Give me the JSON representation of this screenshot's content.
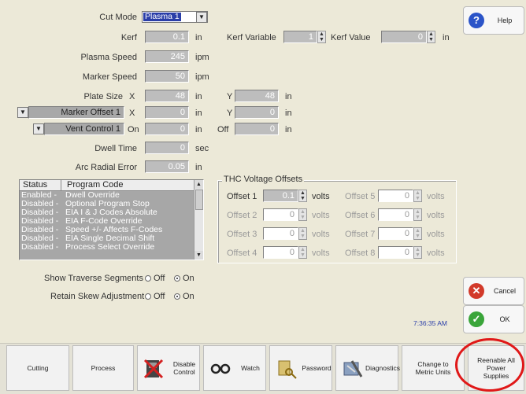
{
  "cut_mode": {
    "label": "Cut Mode",
    "value": "Plasma 1"
  },
  "kerf": {
    "label": "Kerf",
    "value": "0.1",
    "unit": "in"
  },
  "kerf_variable": {
    "label": "Kerf Variable",
    "value": "1"
  },
  "kerf_value": {
    "label": "Kerf Value",
    "value": "0",
    "unit": "in"
  },
  "plasma_speed": {
    "label": "Plasma Speed",
    "value": "245",
    "unit": "ipm"
  },
  "marker_speed": {
    "label": "Marker Speed",
    "value": "50",
    "unit": "ipm"
  },
  "plate_size": {
    "label": "Plate Size",
    "x_label": "X",
    "x_value": "48",
    "x_unit": "in",
    "y_label": "Y",
    "y_value": "48",
    "y_unit": "in"
  },
  "marker_offset": {
    "select": "Marker Offset 1",
    "x_label": "X",
    "x_value": "0",
    "x_unit": "in",
    "y_label": "Y",
    "y_value": "0",
    "y_unit": "in"
  },
  "vent_control": {
    "select": "Vent Control 1",
    "on_label": "On",
    "on_value": "0",
    "on_unit": "in",
    "off_label": "Off",
    "off_value": "0",
    "off_unit": "in"
  },
  "dwell_time": {
    "label": "Dwell Time",
    "value": "0",
    "unit": "sec"
  },
  "arc_radial_error": {
    "label": "Arc Radial Error",
    "value": "0.05",
    "unit": "in"
  },
  "program_codes": {
    "headers": [
      "Status",
      "Program Code"
    ],
    "rows": [
      {
        "status": "Enabled",
        "code": "Dwell Override"
      },
      {
        "status": "Disabled",
        "code": "Optional Program Stop"
      },
      {
        "status": "Disabled",
        "code": "EIA I & J Codes Absolute"
      },
      {
        "status": "Disabled",
        "code": "EIA F-Code Override"
      },
      {
        "status": "Disabled",
        "code": "Speed +/- Affects F-Codes"
      },
      {
        "status": "Disabled",
        "code": "EIA Single Decimal Shift"
      },
      {
        "status": "Disabled",
        "code": "Process Select Override"
      }
    ]
  },
  "thc": {
    "title": "THC Voltage Offsets",
    "unit": "volts",
    "offsets": [
      {
        "label": "Offset 1",
        "value": "0.1"
      },
      {
        "label": "Offset 2",
        "value": "0"
      },
      {
        "label": "Offset 3",
        "value": "0"
      },
      {
        "label": "Offset 4",
        "value": "0"
      },
      {
        "label": "Offset 5",
        "value": "0"
      },
      {
        "label": "Offset 6",
        "value": "0"
      },
      {
        "label": "Offset 7",
        "value": "0"
      },
      {
        "label": "Offset 8",
        "value": "0"
      }
    ]
  },
  "show_traverse": {
    "label": "Show Traverse Segments",
    "off": "Off",
    "on": "On",
    "selected": "On"
  },
  "retain_skew": {
    "label": "Retain Skew Adjustment",
    "off": "Off",
    "on": "On",
    "selected": "On"
  },
  "clock": "7:36:35 AM",
  "side_buttons": {
    "help": "Help",
    "cancel": "Cancel",
    "ok": "OK"
  },
  "bottom_buttons": {
    "cutting": "Cutting",
    "process": "Process",
    "disable_control": "Disable Control",
    "watch": "Watch",
    "password": "Password",
    "diagnostics": "Diagnostics",
    "change_units": "Change to Metric Units",
    "reenable": "Reenable All Power Supplies"
  },
  "colors": {
    "background": "#ece9d8",
    "field": "#bdbdbd",
    "highlight": "#2a3ea8",
    "help": "#2b54c8",
    "cancel": "#d23a2a",
    "ok": "#3aa53a",
    "annotation": "#e01818"
  }
}
